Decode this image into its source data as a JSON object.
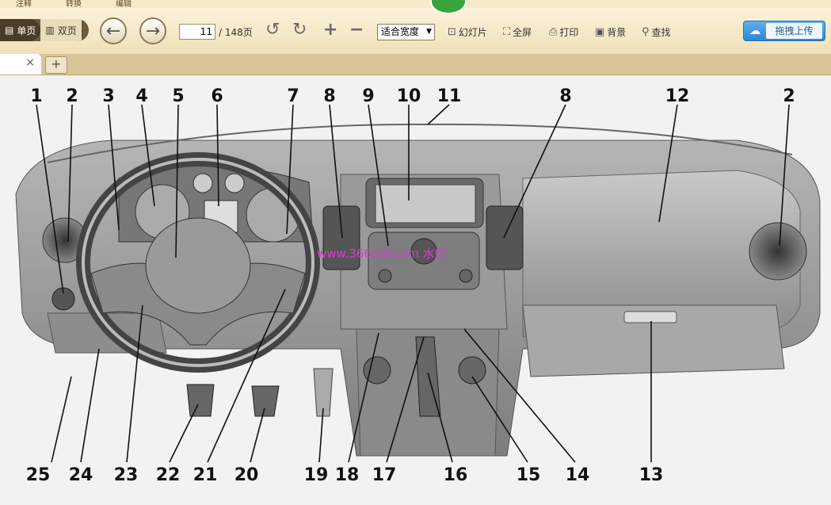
{
  "menu": {
    "items": [
      "注释",
      "转换",
      "编辑"
    ]
  },
  "toolbar": {
    "view_single": "单页",
    "view_double": "双页",
    "page_current": "11",
    "page_total": "/ 148页",
    "zoom": "适合宽度",
    "slideshow": "幻灯片",
    "fullscreen": "全屏",
    "print": "打印",
    "background": "背景",
    "find": "查找",
    "upload": "拖拽上传"
  },
  "tabs": {
    "close": "×",
    "new": "+"
  },
  "figure": {
    "watermark": "www.366pdf.com 水印",
    "callouts_top": [
      "1",
      "2",
      "3",
      "4",
      "5",
      "6",
      "7",
      "8",
      "9",
      "10",
      "11",
      "8",
      "12",
      "2"
    ],
    "callouts_bottom": [
      "25",
      "24",
      "23",
      "22",
      "21",
      "20",
      "19",
      "18",
      "17",
      "16",
      "15",
      "14",
      "13"
    ]
  }
}
